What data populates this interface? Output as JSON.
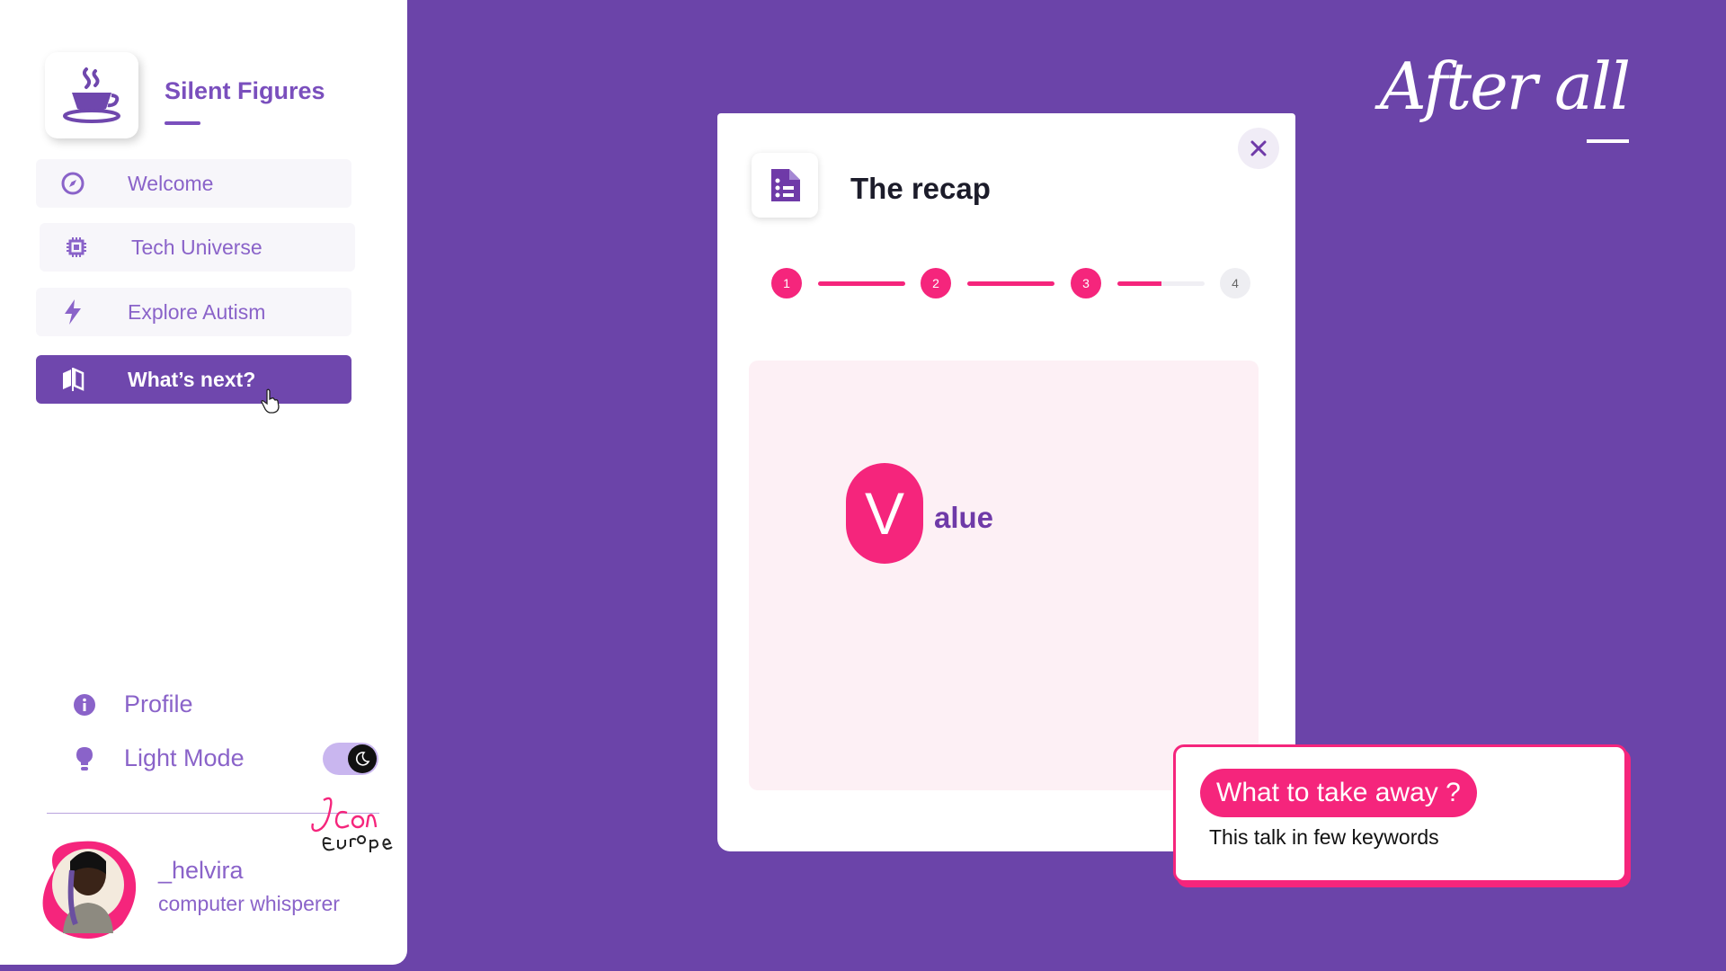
{
  "sidebar": {
    "brand": "Silent Figures",
    "nav": [
      {
        "label": "Welcome",
        "icon": "compass-icon"
      },
      {
        "label": "Tech Universe",
        "icon": "chip-icon"
      },
      {
        "label": "Explore Autism",
        "icon": "lightning-icon"
      },
      {
        "label": "What’s next?",
        "icon": "mirror-icon",
        "active": true
      }
    ],
    "profile_label": "Profile",
    "mode_label": "Light Mode",
    "user": {
      "name": "_helvira",
      "role": "computer whisperer"
    },
    "conference_logo_text": "JCon Europe"
  },
  "header": {
    "title": "After all"
  },
  "modal": {
    "title": "The recap",
    "steps": [
      "1",
      "2",
      "3",
      "4"
    ],
    "progress": [
      1.0,
      1.0,
      0.5
    ],
    "keyword_letter": "V",
    "keyword_rest": "alue"
  },
  "callout": {
    "title": "What to take away ?",
    "subtitle": "This talk in few keywords"
  },
  "colors": {
    "background": "#6b44a9",
    "accent": "#f5257c",
    "sidebar_text": "#8a63c9",
    "active_nav": "#6f47ad"
  }
}
